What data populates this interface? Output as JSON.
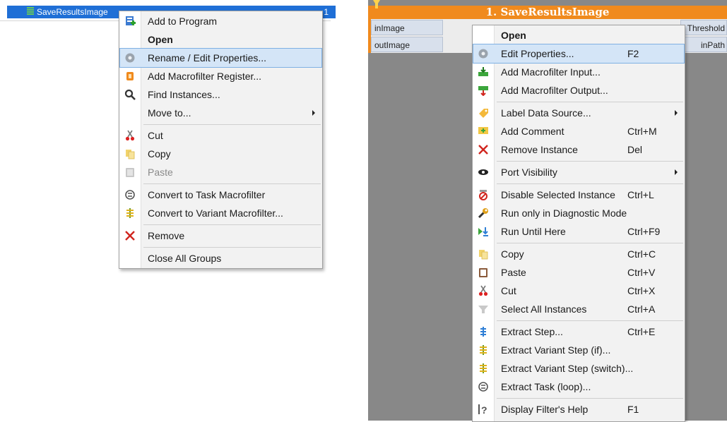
{
  "tree": {
    "item_label": "SaveResultsImage",
    "item_number": "1"
  },
  "left_menu": {
    "items": [
      {
        "label": "Add to Program",
        "icon": "add-to-program-icon"
      },
      {
        "label": "Open",
        "icon": "",
        "bold": true
      },
      {
        "label": "Rename / Edit Properties...",
        "icon": "gear-icon",
        "highlighted": true
      },
      {
        "label": "Add Macrofilter Register...",
        "icon": "register-icon"
      },
      {
        "label": "Find Instances...",
        "icon": "magnifier-icon"
      },
      {
        "label": "Move to...",
        "icon": "",
        "submenu": true
      },
      {
        "label": "Cut",
        "icon": "scissors-icon"
      },
      {
        "label": "Copy",
        "icon": "copy-icon"
      },
      {
        "label": "Paste",
        "icon": "paste-icon",
        "disabled": true
      },
      {
        "label": "Convert to Task Macrofilter",
        "icon": "task-loop-icon"
      },
      {
        "label": "Convert to Variant Macrofilter...",
        "icon": "variant-icon"
      },
      {
        "label": "Remove",
        "icon": "red-x-icon"
      },
      {
        "label": "Close All Groups",
        "icon": ""
      }
    ]
  },
  "block": {
    "title": "1. SaveResultsImage",
    "ports_in": [
      "inImage",
      "outImage"
    ],
    "ports_right": [
      "Threshold",
      "inPath"
    ]
  },
  "right_menu": {
    "items": [
      {
        "label": "Open",
        "shortcut": "",
        "icon": "",
        "bold": true
      },
      {
        "label": "Edit Properties...",
        "shortcut": "F2",
        "icon": "gear-icon",
        "highlighted": true
      },
      {
        "label": "Add Macrofilter Input...",
        "shortcut": "",
        "icon": "add-input-icon"
      },
      {
        "label": "Add Macrofilter Output...",
        "shortcut": "",
        "icon": "add-output-icon"
      },
      {
        "label": "Label Data Source...",
        "shortcut": "",
        "icon": "label-icon",
        "submenu": true
      },
      {
        "label": "Add Comment",
        "shortcut": "Ctrl+M",
        "icon": "comment-icon"
      },
      {
        "label": "Remove Instance",
        "shortcut": "Del",
        "icon": "red-x-icon"
      },
      {
        "label": "Port Visibility",
        "shortcut": "",
        "icon": "eye-icon",
        "submenu": true
      },
      {
        "label": "Disable Selected Instance",
        "shortcut": "Ctrl+L",
        "icon": "disable-icon"
      },
      {
        "label": "Run only in Diagnostic Mode",
        "shortcut": "",
        "icon": "wrench-icon"
      },
      {
        "label": "Run Until Here",
        "shortcut": "Ctrl+F9",
        "icon": "run-until-icon"
      },
      {
        "label": "Copy",
        "shortcut": "Ctrl+C",
        "icon": "copy-icon"
      },
      {
        "label": "Paste",
        "shortcut": "Ctrl+V",
        "icon": "paste-icon"
      },
      {
        "label": "Cut",
        "shortcut": "Ctrl+X",
        "icon": "scissors-icon"
      },
      {
        "label": "Select All Instances",
        "shortcut": "Ctrl+A",
        "icon": "funnel-icon"
      },
      {
        "label": "Extract Step...",
        "shortcut": "Ctrl+E",
        "icon": "step-icon"
      },
      {
        "label": "Extract Variant Step (if)...",
        "shortcut": "",
        "icon": "variant-icon"
      },
      {
        "label": "Extract Variant Step (switch)...",
        "shortcut": "",
        "icon": "variant-icon"
      },
      {
        "label": "Extract Task (loop)...",
        "shortcut": "",
        "icon": "task-loop-icon"
      },
      {
        "label": "Display Filter's Help",
        "shortcut": "F1",
        "icon": "help-icon"
      }
    ]
  },
  "colors": {
    "selection_blue": "#1f6fd6",
    "block_orange": "#f08a1d",
    "menu_highlight": "#d4e5f7"
  }
}
